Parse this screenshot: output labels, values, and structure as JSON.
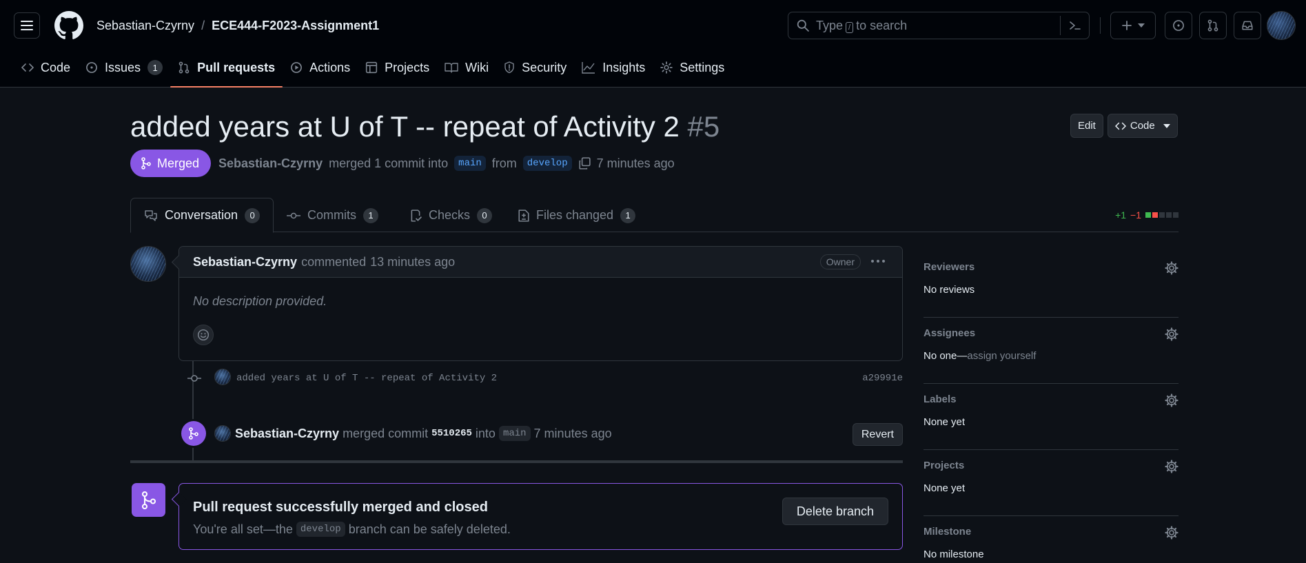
{
  "header": {
    "owner": "Sebastian-Czyrny",
    "separator": "/",
    "repo": "ECE444-F2023-Assignment1",
    "search_prefix": "Type",
    "search_key": "/",
    "search_suffix": "to search"
  },
  "repo_nav": {
    "items": [
      {
        "label": "Code"
      },
      {
        "label": "Issues",
        "count": "1"
      },
      {
        "label": "Pull requests"
      },
      {
        "label": "Actions"
      },
      {
        "label": "Projects"
      },
      {
        "label": "Wiki"
      },
      {
        "label": "Security"
      },
      {
        "label": "Insights"
      },
      {
        "label": "Settings"
      }
    ]
  },
  "pr": {
    "title": "added years at U of T -- repeat of Activity 2",
    "number": "#5",
    "edit_label": "Edit",
    "code_label": "Code",
    "state_label": "Merged",
    "author": "Sebastian-Czyrny",
    "merged_text": "merged 1 commit into",
    "base_branch": "main",
    "from_text": "from",
    "head_branch": "develop",
    "time": "7 minutes ago"
  },
  "tabs": [
    {
      "label": "Conversation",
      "count": "0"
    },
    {
      "label": "Commits",
      "count": "1"
    },
    {
      "label": "Checks",
      "count": "0"
    },
    {
      "label": "Files changed",
      "count": "1"
    }
  ],
  "diffstat": {
    "additions": "+1",
    "deletions": "−1"
  },
  "comment": {
    "author": "Sebastian-Czyrny",
    "action": "commented",
    "time": "13 minutes ago",
    "role": "Owner",
    "body": "No description provided."
  },
  "commit": {
    "message": "added years at U of T -- repeat of Activity 2",
    "sha": "a29991e"
  },
  "merge_event": {
    "author": "Sebastian-Czyrny",
    "text1": "merged commit",
    "sha": "5510265",
    "text2": "into",
    "branch": "main",
    "time": "7 minutes ago",
    "revert_label": "Revert"
  },
  "merged_box": {
    "title": "Pull request successfully merged and closed",
    "sub_prefix": "You're all set—the",
    "branch": "develop",
    "sub_suffix": "branch can be safely deleted.",
    "delete_label": "Delete branch"
  },
  "sidebar": {
    "reviewers_title": "Reviewers",
    "reviewers_value": "No reviews",
    "assignees_title": "Assignees",
    "assignees_value": "No one—",
    "assignees_link": "assign yourself",
    "labels_title": "Labels",
    "labels_value": "None yet",
    "projects_title": "Projects",
    "projects_value": "None yet",
    "milestone_title": "Milestone",
    "milestone_value": "No milestone"
  },
  "colors": {
    "background": "#0d1117",
    "header_bg": "#010409",
    "merged_purple": "#8957e5",
    "active_tab_underline": "#f78166",
    "link_blue": "#58a6ff",
    "addition_green": "#3fb950",
    "deletion_red": "#f85149"
  },
  "icons": [
    "hamburger-icon",
    "github-logo-icon",
    "search-icon",
    "command-palette-icon",
    "plus-icon",
    "issue-icon",
    "pull-request-icon",
    "inbox-icon",
    "code-icon",
    "play-icon",
    "table-icon",
    "book-icon",
    "shield-icon",
    "graph-icon",
    "gear-icon",
    "merge-icon",
    "copy-icon",
    "comment-discussion-icon",
    "commit-icon",
    "checklist-icon",
    "file-diff-icon",
    "kebab-horizontal-icon",
    "smiley-icon",
    "caret-down-icon"
  ]
}
